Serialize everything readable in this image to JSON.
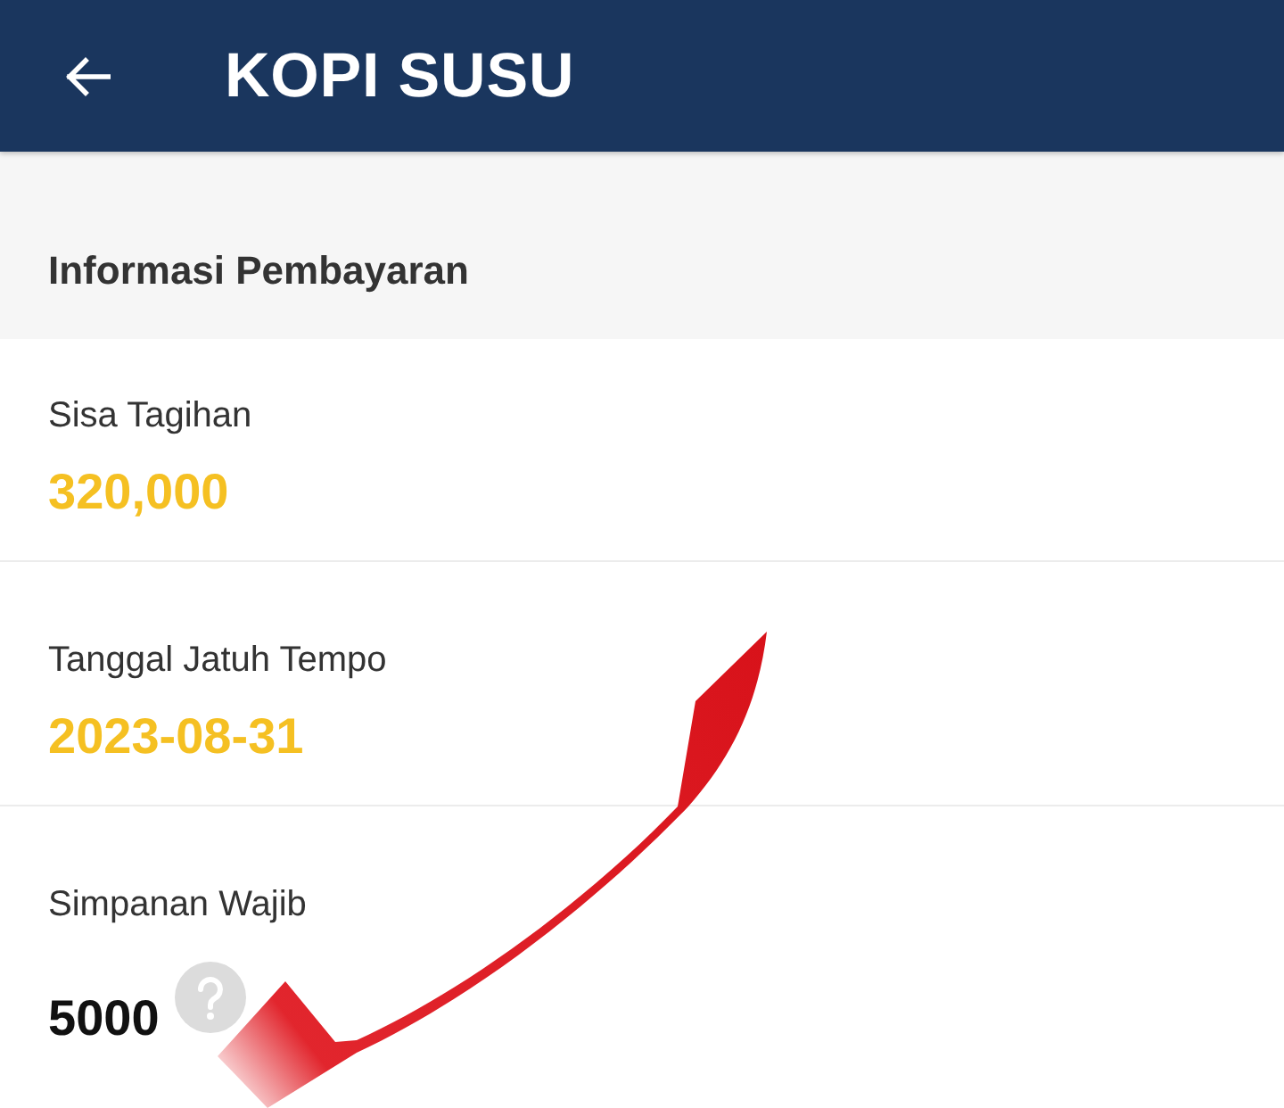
{
  "app_bar": {
    "title": "KOPI SUSU"
  },
  "section": {
    "title": "Informasi Pembayaran"
  },
  "fields": [
    {
      "kind": "highlight",
      "label": "Sisa Tagihan",
      "value": "320,000"
    },
    {
      "kind": "highlight",
      "label": "Tanggal Jatuh Tempo",
      "value": "2023-08-31"
    },
    {
      "kind": "help",
      "label": "Simpanan Wajib",
      "value": "5000"
    }
  ],
  "annotation": {
    "kind": "arrow"
  }
}
